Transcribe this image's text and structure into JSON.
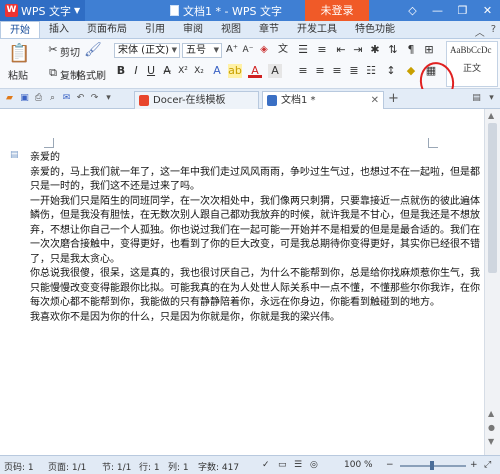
{
  "titlebar": {
    "app_name": "WPS 文字",
    "doc_title": "文档1 * - WPS 文字",
    "login": "未登录"
  },
  "menu": {
    "tabs": [
      "开始",
      "插入",
      "页面布局",
      "引用",
      "审阅",
      "视图",
      "章节",
      "开发工具",
      "特色功能"
    ]
  },
  "ribbon": {
    "paste": "粘贴",
    "cut": "剪切",
    "copy": "复制",
    "format_painter": "格式刷",
    "font": "宋体 (正文)",
    "size": "五号",
    "style_sample": "AaBbCcDc",
    "style_name": "正文"
  },
  "tabs": {
    "items": [
      "Docer-在线模板",
      "文档1 *"
    ]
  },
  "document": {
    "lines": [
      "亲爱的",
      "亲爱的，马上我们就一年了，这一年中我们走过风风雨雨，争吵过生气过，也想过不在一起啦，但是都只是一时的，我们这不还是过来了吗。",
      "一开始我们只是陌生的同班同学，在一次次相处中，我们像两只刺猬，只要靠接近一点就伤的彼此遍体鳞伤，但是我没有胆怯，在无数次别人跟自己都劝我放弃的时候，就许我是不甘心，但是我还是不想放弃，不想让你自己一个人孤独。你也说过我们在一起可能一开始并不是相爱的但是是最合适的。我们在一次次磨合接触中，变得更好，也看到了你的巨大改变，可是我总期待你变得更好，其实你已经很不错了，只是我太贪心。",
      "你总说我很傻，很呆，这是真的，我也很讨厌自己，为什么不能帮到你，总是给你找麻烦惹你生气，我只能慢慢改变变得能跟你比拟。可能我真的在为人处世人际关系中一点不懂，不懂那些尔你我诈，在你每次烦心都不能帮到你，我能做的只有静静陪着你，永远在你身边，你能看到触碰到的地方。",
      "我喜欢你不是因为你的什么，只是因为你就是你，你就是我的梁兴伟。"
    ]
  },
  "status": {
    "page": "页码: 1",
    "pages": "页面: 1/1",
    "section": "节: 1/1",
    "line": "行: 1",
    "column": "列: 1",
    "word_count": "字数: 417",
    "zoom": "100 %"
  }
}
